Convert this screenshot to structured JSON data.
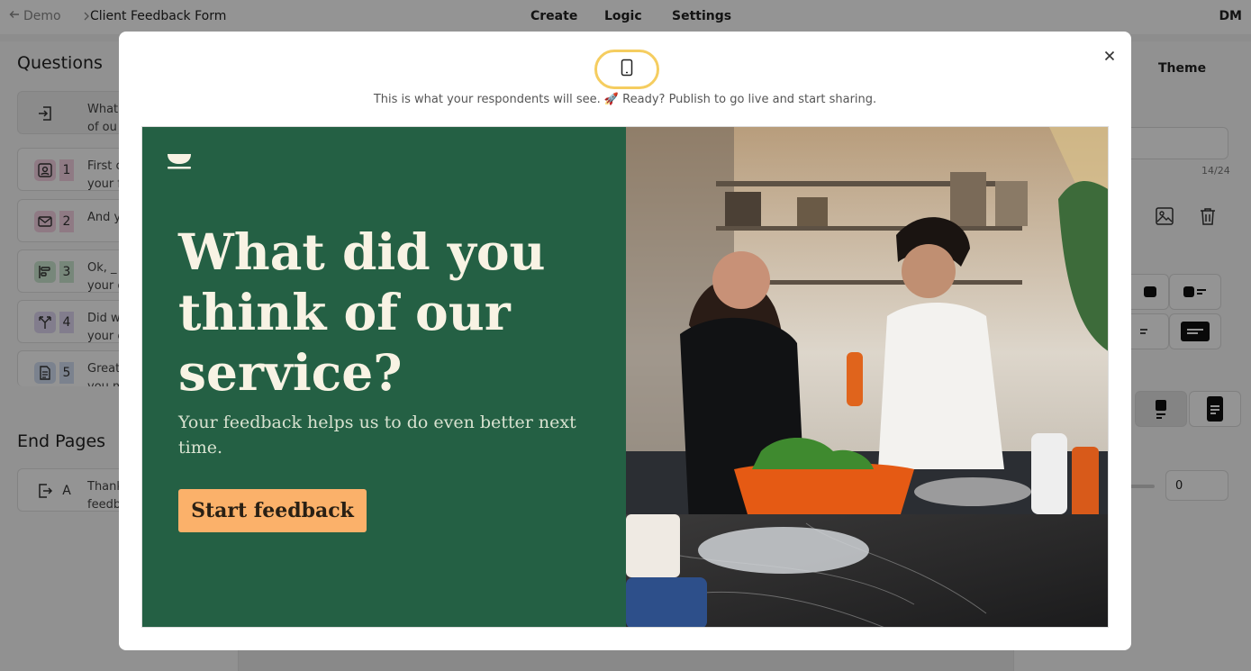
{
  "topbar": {
    "back_label": "Demo",
    "title": "Client Feedback Form",
    "tabs": [
      "Create",
      "Logic",
      "Settings"
    ],
    "avatar_initials": "DM"
  },
  "left_panel": {
    "questions_heading": "Questions",
    "questions": [
      {
        "icon": "enter-icon",
        "number": "",
        "text": "What\nof ou"
      },
      {
        "icon": "contact-icon",
        "number": "1",
        "text": "First c\nyour f"
      },
      {
        "icon": "mail-icon",
        "number": "2",
        "text": "And y"
      },
      {
        "icon": "align-left-icon",
        "number": "3",
        "text": "Ok, _\nyour c"
      },
      {
        "icon": "split-icon",
        "number": "4",
        "text": "Did w\nyour e"
      },
      {
        "icon": "document-icon",
        "number": "5",
        "text": "Great\nyou m"
      }
    ],
    "end_pages_heading": "End Pages",
    "end_pages": [
      {
        "icon": "exit-icon",
        "letter": "A",
        "text": "Thank\nfeedb"
      }
    ]
  },
  "right_panel": {
    "tab": "Theme",
    "char_count": "14/24",
    "number_value": "0"
  },
  "modal": {
    "notice": "This is what your respondents will see. 🚀 Ready? Publish to go live and start sharing.",
    "preview": {
      "headline": "What did you think of our service?",
      "subline": "Your feedback helps us to do even better next time.",
      "cta_label": "Start feedback"
    }
  },
  "colors": {
    "preview_bg": "#246044",
    "headline": "#f8f3e4",
    "cta_bg": "#fbb16a",
    "toggle_outline": "#f5cd60"
  }
}
